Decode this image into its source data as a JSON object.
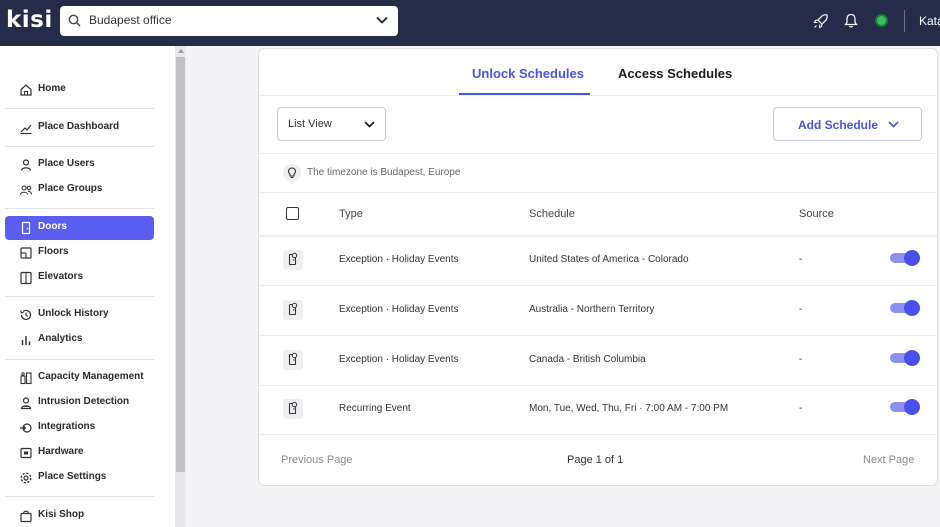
{
  "app": {
    "logo": "kisi",
    "user_name": "Kata"
  },
  "place_selector": {
    "value": "Budapest office"
  },
  "topbar_icons": [
    "rocket-icon",
    "bell-icon",
    "status-online-icon"
  ],
  "colors": {
    "topbar": "#252c4a",
    "accent": "#4a55e0",
    "active_nav": "#5a5ff0",
    "toggle_on": "#4a50ee",
    "status_online": "#36c25b"
  },
  "sidebar": {
    "items": [
      {
        "label": "Home",
        "icon": "home-icon",
        "active": false
      },
      {
        "label": "Place Dashboard",
        "icon": "chart-line-icon",
        "active": false
      },
      {
        "label": "Place Users",
        "icon": "user-icon",
        "active": false
      },
      {
        "label": "Place Groups",
        "icon": "users-icon",
        "active": false
      },
      {
        "label": "Doors",
        "icon": "door-icon",
        "active": true
      },
      {
        "label": "Floors",
        "icon": "layers-icon",
        "active": false
      },
      {
        "label": "Elevators",
        "icon": "elevator-icon",
        "active": false
      },
      {
        "label": "Unlock History",
        "icon": "history-icon",
        "active": false
      },
      {
        "label": "Analytics",
        "icon": "bar-chart-icon",
        "active": false
      },
      {
        "label": "Capacity Management",
        "icon": "capacity-icon",
        "active": false
      },
      {
        "label": "Intrusion Detection",
        "icon": "intrusion-icon",
        "active": false
      },
      {
        "label": "Integrations",
        "icon": "integrations-icon",
        "active": false
      },
      {
        "label": "Hardware",
        "icon": "hardware-icon",
        "active": false
      },
      {
        "label": "Place Settings",
        "icon": "gear-icon",
        "active": false
      },
      {
        "label": "Kisi Shop",
        "icon": "shop-icon",
        "active": false
      }
    ]
  },
  "tabs": [
    {
      "label": "Unlock Schedules",
      "active": true
    },
    {
      "label": "Access Schedules",
      "active": false
    }
  ],
  "toolbar": {
    "view_select": "List View",
    "add_button": "Add Schedule"
  },
  "timezone_notice": "The timezone is Budapest, Europe",
  "table": {
    "columns": [
      "Type",
      "Schedule",
      "Source"
    ],
    "rows": [
      {
        "type": "Exception · Holiday Events",
        "schedule": "United States of America - Colorado",
        "source": "-",
        "enabled": true
      },
      {
        "type": "Exception · Holiday Events",
        "schedule": "Australia - Northern Territory",
        "source": "-",
        "enabled": true
      },
      {
        "type": "Exception · Holiday Events",
        "schedule": "Canada - British Columbia",
        "source": "-",
        "enabled": true
      },
      {
        "type": "Recurring Event",
        "schedule": "Mon, Tue, Wed, Thu, Fri · 7:00 AM - 7:00 PM",
        "source": "-",
        "enabled": true
      }
    ]
  },
  "pagination": {
    "previous": "Previous Page",
    "info": "Page 1 of 1",
    "next": "Next Page"
  }
}
